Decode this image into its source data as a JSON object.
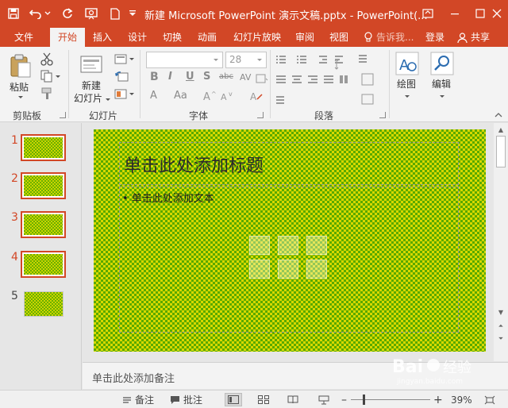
{
  "window": {
    "title": "新建 Microsoft PowerPoint 演示文稿.pptx - PowerPoint(..."
  },
  "tabs": [
    {
      "label": "文件"
    },
    {
      "label": "开始"
    },
    {
      "label": "插入"
    },
    {
      "label": "设计"
    },
    {
      "label": "切换"
    },
    {
      "label": "动画"
    },
    {
      "label": "幻灯片放映"
    },
    {
      "label": "审阅"
    },
    {
      "label": "视图"
    }
  ],
  "tell_me": "告诉我...",
  "login": "登录",
  "share": "共享",
  "ribbon": {
    "paste": "粘贴",
    "clipboard_group": "剪贴板",
    "new_slide_line1": "新建",
    "new_slide_line2": "幻灯片",
    "slides_group": "幻灯片",
    "font_size": "28",
    "font_group": "字体",
    "paragraph_group": "段落",
    "drawing": "绘图",
    "editing": "编辑",
    "bold": "B",
    "italic": "I",
    "underline": "U",
    "shadow": "S",
    "strike": "abc",
    "spacing": "AV",
    "font_a": "A",
    "font_aa": "Aa"
  },
  "thumbnails": [
    {
      "number": "1"
    },
    {
      "number": "2"
    },
    {
      "number": "3"
    },
    {
      "number": "4"
    },
    {
      "number": "5"
    }
  ],
  "slide": {
    "title_placeholder": "单击此处添加标题",
    "body_placeholder": "• 单击此处添加文本"
  },
  "notes": {
    "placeholder": "单击此处添加备注"
  },
  "statusbar": {
    "notes": "备注",
    "comments": "批注",
    "zoom_minus": "–",
    "zoom_plus": "+",
    "zoom": "39%"
  },
  "watermark": {
    "brand": "Bai",
    "brand2": "经验",
    "url": "jingyan.baidu.com"
  },
  "colors": {
    "accent": "#d24726",
    "slide_green": "#6fb300",
    "slide_yellow": "#d8d800"
  }
}
